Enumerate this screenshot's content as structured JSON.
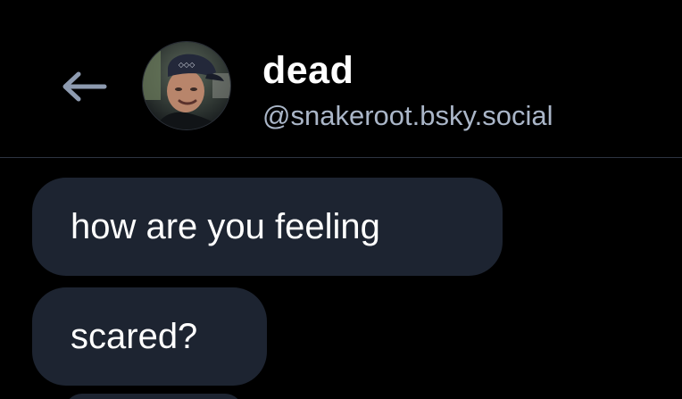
{
  "header": {
    "back_icon": "arrow-left-icon",
    "avatar_icon": "profile-photo-avatar",
    "display_name": "dead",
    "handle": "@snakeroot.bsky.social"
  },
  "messages": [
    {
      "text": "how are you feeling"
    },
    {
      "text": "scared?"
    }
  ],
  "colors": {
    "background": "#000000",
    "bubble": "#1d2431",
    "handle_text": "#aab6c8",
    "back_arrow": "#8e9bb0",
    "divider": "#2d3441"
  }
}
